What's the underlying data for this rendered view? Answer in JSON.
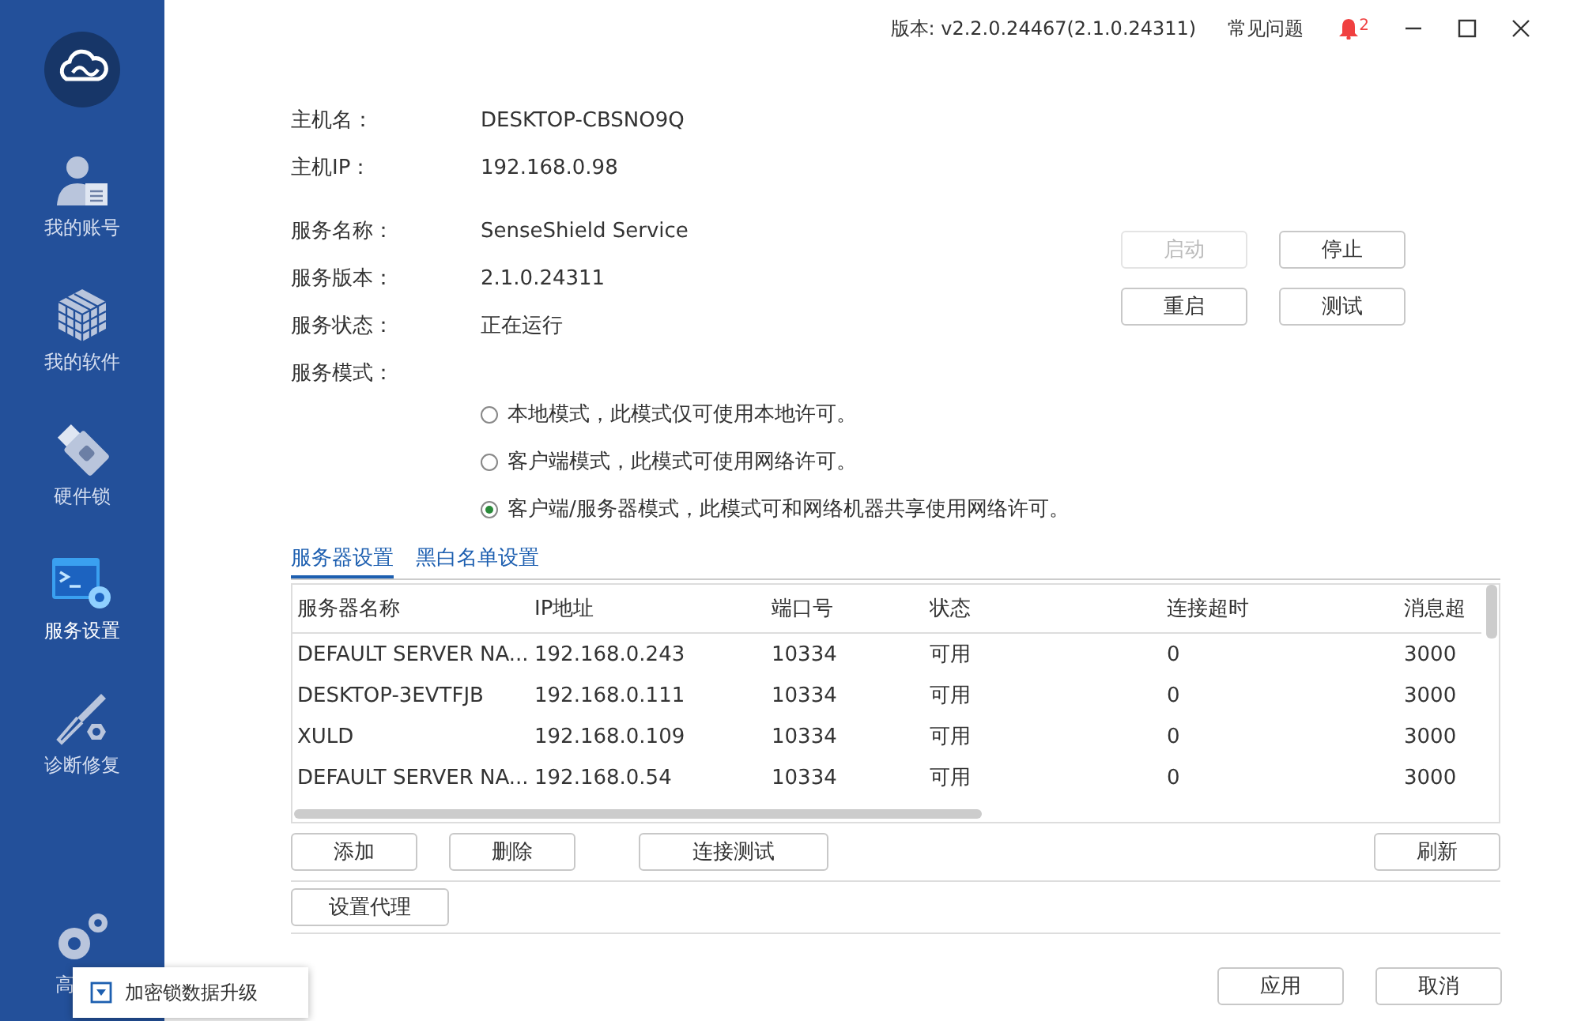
{
  "titlebar": {
    "version": "版本: v2.2.0.24467(2.1.0.24311)",
    "faq": "常见问题",
    "notification_count": "2"
  },
  "sidebar": {
    "items": [
      {
        "label": "我的账号",
        "kind": "account",
        "selected": false
      },
      {
        "label": "我的软件",
        "kind": "software",
        "selected": false
      },
      {
        "label": "硬件锁",
        "kind": "dongle",
        "selected": false
      },
      {
        "label": "服务设置",
        "kind": "service",
        "selected": true
      },
      {
        "label": "诊断修复",
        "kind": "repair",
        "selected": false
      }
    ],
    "bottom_item": {
      "label": "高"
    },
    "popup": {
      "label": "加密锁数据升级"
    }
  },
  "info": [
    {
      "label": "主机名：",
      "value": "DESKTOP-CBSNO9Q"
    },
    {
      "label": "主机IP：",
      "value": "192.168.0.98"
    },
    {
      "label": "服务名称：",
      "value": "SenseShield Service"
    },
    {
      "label": "服务版本：",
      "value": "2.1.0.24311"
    },
    {
      "label": "服务状态：",
      "value": "正在运行"
    }
  ],
  "service_buttons": [
    {
      "label": "启动",
      "disabled": true
    },
    {
      "label": "停止",
      "disabled": false
    },
    {
      "label": "重启",
      "disabled": false
    },
    {
      "label": "测试",
      "disabled": false
    }
  ],
  "mode": {
    "label": "服务模式：",
    "options": [
      {
        "label": "本地模式，此模式仅可使用本地许可。",
        "selected": false
      },
      {
        "label": "客户端模式，此模式可使用网络许可。",
        "selected": false
      },
      {
        "label": "客户端/服务器模式，此模式可和网络机器共享使用网络许可。",
        "selected": true
      }
    ]
  },
  "tabs": [
    {
      "label": "服务器设置",
      "selected": true
    },
    {
      "label": "黑白名单设置",
      "selected": false
    }
  ],
  "table": {
    "columns": [
      "服务器名称",
      "IP地址",
      "端口号",
      "状态",
      "连接超时",
      "消息超"
    ],
    "rows": [
      [
        "DEFAULT SERVER NA...",
        "192.168.0.243",
        "10334",
        "可用",
        "0",
        "3000"
      ],
      [
        "DESKTOP-3EVTFJB",
        "192.168.0.111",
        "10334",
        "可用",
        "0",
        "3000"
      ],
      [
        "XULD",
        "192.168.0.109",
        "10334",
        "可用",
        "0",
        "3000"
      ],
      [
        "DEFAULT SERVER NA...",
        "192.168.0.54",
        "10334",
        "可用",
        "0",
        "3000"
      ]
    ]
  },
  "table_buttons": [
    "添加",
    "删除",
    "连接测试",
    "刷新"
  ],
  "proxy_button": "设置代理",
  "footer_buttons": [
    "应用",
    "取消"
  ]
}
